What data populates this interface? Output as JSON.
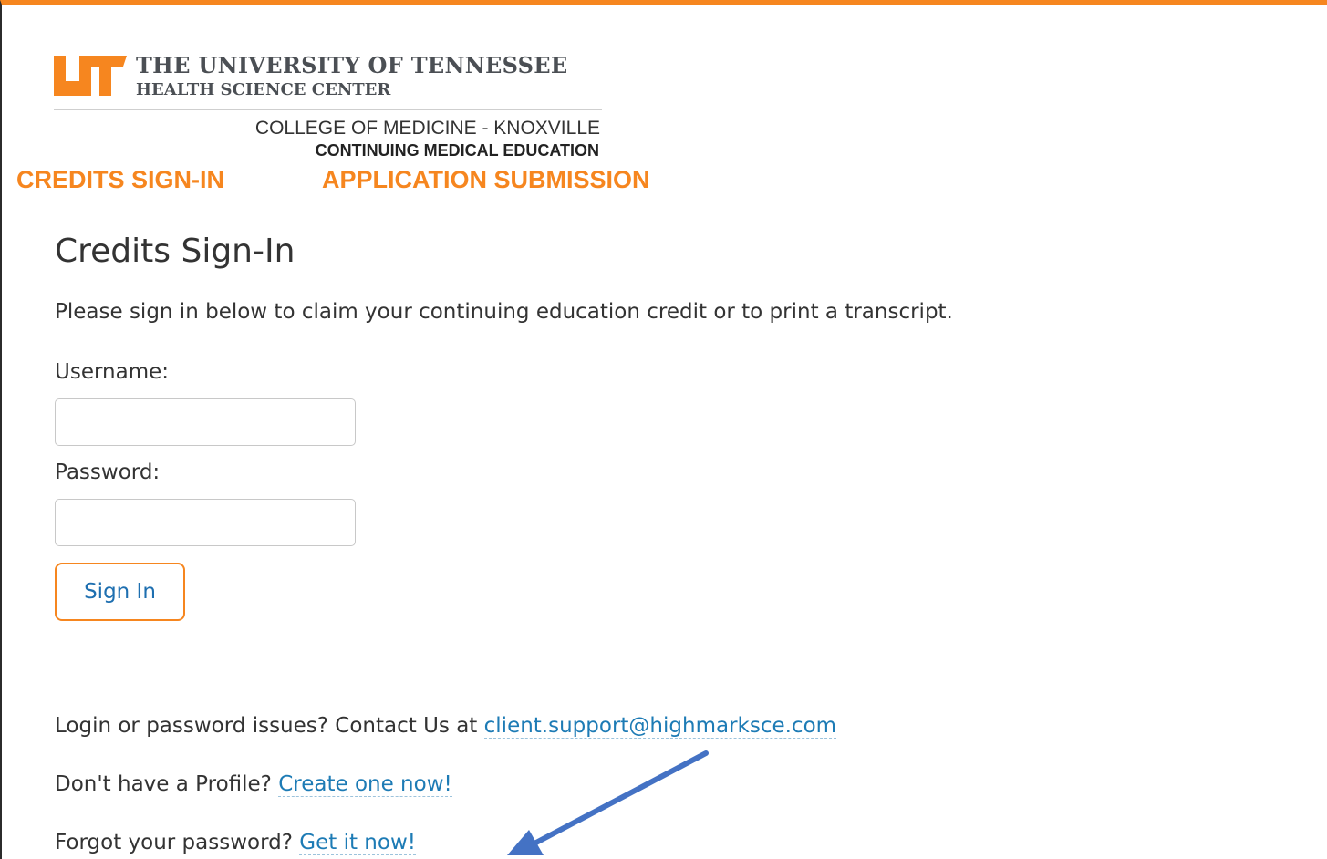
{
  "header": {
    "logo_title": "THE UNIVERSITY OF TENNESSEE",
    "logo_subtitle": "HEALTH SCIENCE CENTER",
    "college": "COLLEGE OF MEDICINE - KNOXVILLE",
    "department": "CONTINUING MEDICAL EDUCATION"
  },
  "nav": {
    "items": [
      {
        "label": "CREDITS SIGN-IN"
      },
      {
        "label": "APPLICATION SUBMISSION"
      }
    ]
  },
  "main": {
    "title": "Credits Sign-In",
    "intro": "Please sign in below to claim your continuing education credit or to print a transcript.",
    "username_label": "Username:",
    "username_value": "",
    "password_label": "Password:",
    "password_value": "",
    "sign_in_label": "Sign In"
  },
  "footer": {
    "support_text": "Login or password issues? Contact Us at ",
    "support_link": "client.support@highmarksce.com",
    "profile_text": "Don't have a Profile? ",
    "profile_link": "Create one now!",
    "forgot_text": "Forgot your password? ",
    "forgot_link": "Get it now!"
  },
  "colors": {
    "accent_orange": "#f6861f",
    "link_blue": "#1d7bb5",
    "annotation_arrow": "#4472c4"
  },
  "icons": {
    "logo": "ut-logo-icon",
    "annotation": "arrow-icon"
  }
}
